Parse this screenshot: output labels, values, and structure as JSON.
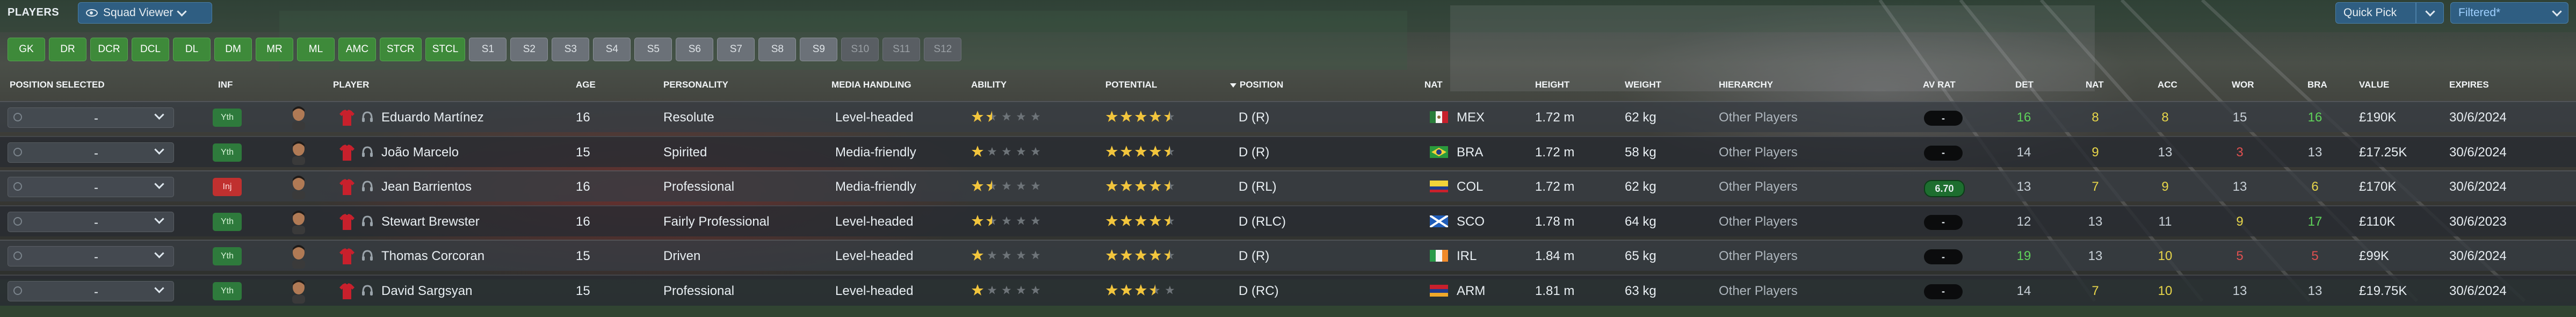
{
  "header": {
    "title": "PLAYERS",
    "view_selector": "Squad Viewer",
    "quick_pick": "Quick Pick",
    "filter": "Filtered*"
  },
  "position_filters": [
    {
      "label": "GK",
      "state": "on"
    },
    {
      "label": "DR",
      "state": "on"
    },
    {
      "label": "DCR",
      "state": "on"
    },
    {
      "label": "DCL",
      "state": "on"
    },
    {
      "label": "DL",
      "state": "on"
    },
    {
      "label": "DM",
      "state": "on"
    },
    {
      "label": "MR",
      "state": "on"
    },
    {
      "label": "ML",
      "state": "on"
    },
    {
      "label": "AMC",
      "state": "on"
    },
    {
      "label": "STCR",
      "state": "on"
    },
    {
      "label": "STCL",
      "state": "on"
    },
    {
      "label": "S1",
      "state": "off"
    },
    {
      "label": "S2",
      "state": "off"
    },
    {
      "label": "S3",
      "state": "off"
    },
    {
      "label": "S4",
      "state": "off"
    },
    {
      "label": "S5",
      "state": "off"
    },
    {
      "label": "S6",
      "state": "off"
    },
    {
      "label": "S7",
      "state": "off"
    },
    {
      "label": "S8",
      "state": "off"
    },
    {
      "label": "S9",
      "state": "off"
    },
    {
      "label": "S10",
      "state": "dis"
    },
    {
      "label": "S11",
      "state": "dis"
    },
    {
      "label": "S12",
      "state": "dis"
    }
  ],
  "columns": {
    "position_selected": "POSITION SELECTED",
    "inf": "INF",
    "player": "PLAYER",
    "age": "AGE",
    "personality": "PERSONALITY",
    "media_handling": "MEDIA HANDLING",
    "ability": "ABILITY",
    "potential": "POTENTIAL",
    "position": "POSITION",
    "nat": "NAT",
    "height": "HEIGHT",
    "weight": "WEIGHT",
    "hierarchy": "HIERARCHY",
    "av_rat": "AV RAT",
    "det": "DET",
    "nat_attr": "NAT",
    "acc": "ACC",
    "wor": "WOR",
    "bra": "BRA",
    "value": "VALUE",
    "expires": "EXPIRES"
  },
  "colors": {
    "attr_green": "#5fd35a",
    "attr_yellow": "#e8d64a",
    "attr_red": "#e05050",
    "attr_plain": "#c9d1d8",
    "star_gold": "#f2c53d",
    "star_grey": "#6e7479"
  },
  "players": [
    {
      "selected": "-",
      "inf": "Yth",
      "inf_type": "yth",
      "name": "Eduardo Martínez",
      "age": "16",
      "personality": "Resolute",
      "media": "Level-headed",
      "ability_stars": 1.5,
      "potential_stars": 4.5,
      "position": "D (R)",
      "nat": "MEX",
      "flag": "mex",
      "height": "1.72 m",
      "weight": "62 kg",
      "hierarchy": "Other Players",
      "av_rat": "-",
      "det": {
        "v": "16",
        "c": "green"
      },
      "nat_attr": {
        "v": "8",
        "c": "yellow"
      },
      "acc": {
        "v": "8",
        "c": "yellow"
      },
      "wor": {
        "v": "15",
        "c": "plain"
      },
      "bra": {
        "v": "16",
        "c": "green"
      },
      "value": "£190K",
      "expires": "30/6/2024"
    },
    {
      "selected": "-",
      "inf": "Yth",
      "inf_type": "yth",
      "name": "João Marcelo",
      "age": "15",
      "personality": "Spirited",
      "media": "Media-friendly",
      "ability_stars": 1,
      "potential_stars": 4.5,
      "position": "D (R)",
      "nat": "BRA",
      "flag": "bra",
      "height": "1.72 m",
      "weight": "58 kg",
      "hierarchy": "Other Players",
      "av_rat": "-",
      "det": {
        "v": "14",
        "c": "plain"
      },
      "nat_attr": {
        "v": "9",
        "c": "yellow"
      },
      "acc": {
        "v": "13",
        "c": "plain"
      },
      "wor": {
        "v": "3",
        "c": "red"
      },
      "bra": {
        "v": "13",
        "c": "plain"
      },
      "value": "£17.25K",
      "expires": "30/6/2024"
    },
    {
      "selected": "-",
      "inf": "Inj",
      "inf_type": "inj",
      "name": "Jean Barrientos",
      "age": "16",
      "personality": "Professional",
      "media": "Media-friendly",
      "ability_stars": 1.5,
      "potential_stars": 4.5,
      "position": "D (RL)",
      "nat": "COL",
      "flag": "col",
      "height": "1.72 m",
      "weight": "62 kg",
      "hierarchy": "Other Players",
      "av_rat": "6.70",
      "det": {
        "v": "13",
        "c": "plain"
      },
      "nat_attr": {
        "v": "7",
        "c": "yellow"
      },
      "acc": {
        "v": "9",
        "c": "yellow"
      },
      "wor": {
        "v": "13",
        "c": "plain"
      },
      "bra": {
        "v": "6",
        "c": "yellow"
      },
      "value": "£170K",
      "expires": "30/6/2024"
    },
    {
      "selected": "-",
      "inf": "Yth",
      "inf_type": "yth",
      "name": "Stewart Brewster",
      "age": "16",
      "personality": "Fairly Professional",
      "media": "Level-headed",
      "ability_stars": 1.5,
      "potential_stars": 4.5,
      "position": "D (RLC)",
      "nat": "SCO",
      "flag": "sco",
      "height": "1.78 m",
      "weight": "64 kg",
      "hierarchy": "Other Players",
      "av_rat": "-",
      "det": {
        "v": "12",
        "c": "plain"
      },
      "nat_attr": {
        "v": "13",
        "c": "plain"
      },
      "acc": {
        "v": "11",
        "c": "plain"
      },
      "wor": {
        "v": "9",
        "c": "yellow"
      },
      "bra": {
        "v": "17",
        "c": "green"
      },
      "value": "£110K",
      "expires": "30/6/2023"
    },
    {
      "selected": "-",
      "inf": "Yth",
      "inf_type": "yth",
      "name": "Thomas Corcoran",
      "age": "15",
      "personality": "Driven",
      "media": "Level-headed",
      "ability_stars": 1,
      "potential_stars": 4.5,
      "position": "D (R)",
      "nat": "IRL",
      "flag": "irl",
      "height": "1.84 m",
      "weight": "65 kg",
      "hierarchy": "Other Players",
      "av_rat": "-",
      "det": {
        "v": "19",
        "c": "green"
      },
      "nat_attr": {
        "v": "13",
        "c": "plain"
      },
      "acc": {
        "v": "10",
        "c": "yellow"
      },
      "wor": {
        "v": "5",
        "c": "red"
      },
      "bra": {
        "v": "5",
        "c": "red"
      },
      "value": "£99K",
      "expires": "30/6/2024"
    },
    {
      "selected": "-",
      "inf": "Yth",
      "inf_type": "yth",
      "name": "David Sargsyan",
      "age": "15",
      "personality": "Professional",
      "media": "Level-headed",
      "ability_stars": 1,
      "potential_stars": 3.5,
      "position": "D (RC)",
      "nat": "ARM",
      "flag": "arm",
      "height": "1.81 m",
      "weight": "63 kg",
      "hierarchy": "Other Players",
      "av_rat": "-",
      "det": {
        "v": "14",
        "c": "plain"
      },
      "nat_attr": {
        "v": "7",
        "c": "yellow"
      },
      "acc": {
        "v": "10",
        "c": "yellow"
      },
      "wor": {
        "v": "13",
        "c": "plain"
      },
      "bra": {
        "v": "13",
        "c": "plain"
      },
      "value": "£19.75K",
      "expires": "30/6/2024"
    }
  ]
}
